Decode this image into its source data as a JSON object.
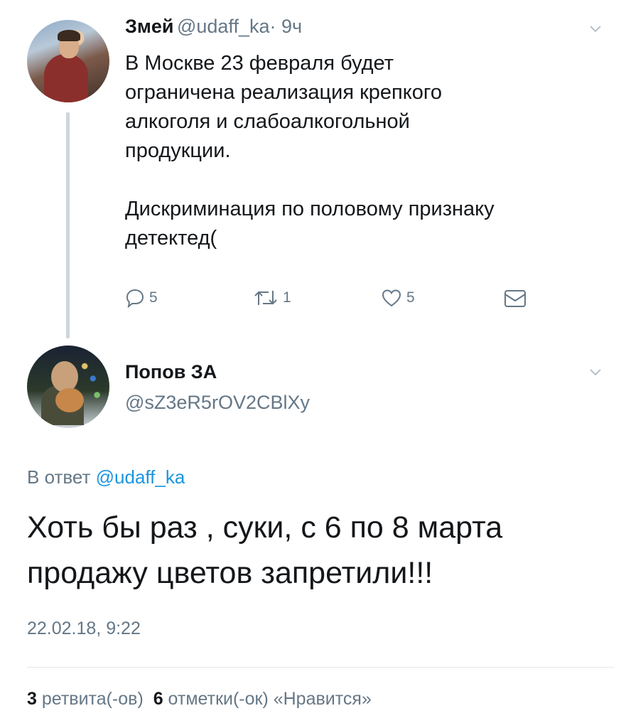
{
  "parent_tweet": {
    "author_name": "Змей",
    "author_handle": "@udaff_ka",
    "time": "· 9ч",
    "text": "В Москве 23 февраля будет\nограничена реализация крепкого\nалкоголя и слабоалкогольной\nпродукции.\n\nДискриминация по половому признаку\nдетектед(",
    "replies": "5",
    "retweets": "1",
    "likes": "5"
  },
  "main_tweet": {
    "author_name": "Попов ЗА",
    "author_handle": "@sZ3eR5rOV2CBlXy",
    "reply_prefix": "В ответ",
    "reply_handle": "@udaff_ka",
    "text": "Хоть бы раз , суки, с 6 по 8 марта\nпродажу цветов запретили!!!",
    "timestamp": "22.02.18, 9:22",
    "retweet_count": "3",
    "retweet_label": "ретвита(-ов)",
    "like_count": "6",
    "like_label": "отметки(-ок) «Нравится»"
  },
  "colors": {
    "accent": "#1b95e0",
    "muted": "#657786",
    "text": "#14171a",
    "line": "#ccd6dd"
  },
  "icons": [
    "chevron-down-icon",
    "reply-icon",
    "retweet-icon",
    "heart-icon",
    "mail-icon"
  ]
}
